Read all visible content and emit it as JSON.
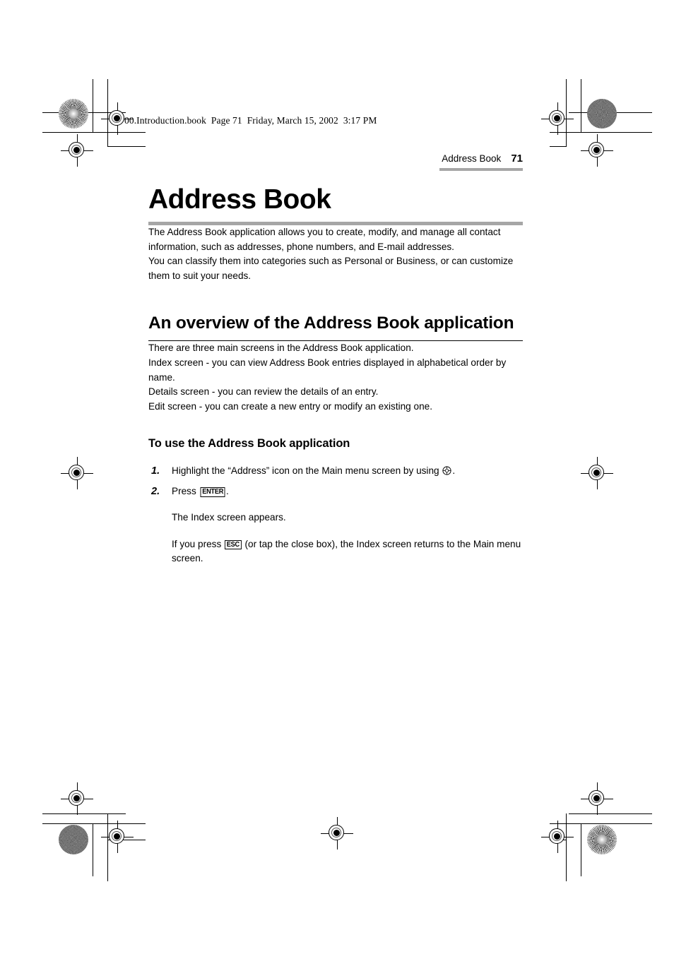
{
  "file_stamp": "00.Introduction.book  Page 71  Friday, March 15, 2002  3:17 PM",
  "running_header": {
    "title": "Address Book",
    "page_number": "71"
  },
  "chapter": {
    "title": "Address Book",
    "intro": "The Address Book application allows you to create, modify, and manage all contact information, such as addresses, phone numbers, and E-mail addresses.\nYou can classify them into categories such as Personal or Business, or can customize them to suit your needs."
  },
  "section": {
    "title": "An overview of the Address Book application",
    "body": "There are three main screens in the Address Book application.\nIndex screen - you can view Address Book entries displayed in alphabetical order by name.\nDetails screen - you can review the details of an entry.\nEdit screen - you can create a new entry or modify an existing one."
  },
  "procedure": {
    "title": "To use the Address Book application",
    "steps": [
      {
        "number": "1.",
        "text_before": "Highlight the “Address” icon on the Main menu screen by using",
        "icon": "dpad-icon",
        "text_after": "."
      },
      {
        "number": "2.",
        "text_before": "Press",
        "key": "ENTER",
        "text_after": "."
      }
    ],
    "notes": [
      {
        "text": "The Index screen appears."
      },
      {
        "text_before": "If you press",
        "key": "ESC",
        "text_after": "(or tap the close box), the Index screen returns to the Main menu screen."
      }
    ]
  },
  "colors": {
    "rule_gray": "#a6a6a6",
    "text": "#000000",
    "page_background": "#ffffff",
    "registration_dot_gray": "#777777"
  },
  "printer_marks": {
    "top_left_target": "rosette-target",
    "top_right_target": "gray-dot-target",
    "bottom_left_target": "gray-dot-target",
    "bottom_right_target": "rosette-target"
  }
}
